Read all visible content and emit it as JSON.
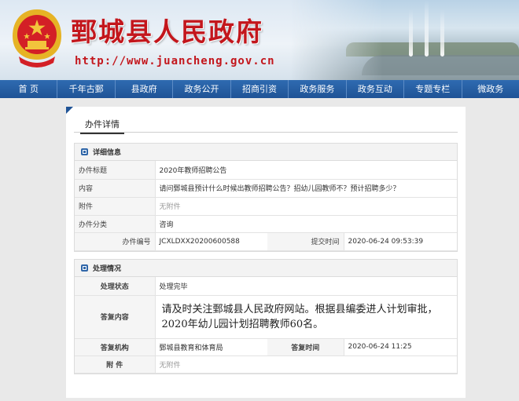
{
  "site": {
    "title": "鄄城县人民政府",
    "url": "http://www.juancheng.gov.cn"
  },
  "nav": {
    "items": [
      "首 页",
      "千年古鄄",
      "县政府",
      "政务公开",
      "招商引资",
      "政务服务",
      "政务互动",
      "专题专栏",
      "微政务"
    ]
  },
  "tab": {
    "title": "办件详情"
  },
  "detail": {
    "heading": "详细信息",
    "title_label": "办件标题",
    "title_value": "2020年教师招聘公告",
    "content_label": "内容",
    "content_value": "请问鄄城县预计什么时候出教师招聘公告？招幼儿园教师不？预计招聘多少？",
    "attachment_label": "附件",
    "attachment_value": "无附件",
    "category_label": "办件分类",
    "category_value": "咨询",
    "number_label": "办件编号",
    "number_value": "JCXLDXX20200600588",
    "submit_time_label": "提交时间",
    "submit_time_value": "2020-06-24 09:53:39"
  },
  "handling": {
    "heading": "处理情况",
    "status_label": "处理状态",
    "status_value": "处理完毕",
    "reply_label": "答复内容",
    "reply_value": "请及时关注鄄城县人民政府网站。根据县编委进人计划审批，2020年幼儿园计划招聘教师60名。",
    "org_label": "答复机构",
    "org_value": "鄄城县教育和体育局",
    "reply_time_label": "答复时间",
    "reply_time_value": "2020-06-24 11:25",
    "attachment_label": "附 件",
    "attachment_value": "无附件"
  },
  "colors": {
    "brand_red": "#c3161c",
    "nav_blue": "#1f5396"
  }
}
